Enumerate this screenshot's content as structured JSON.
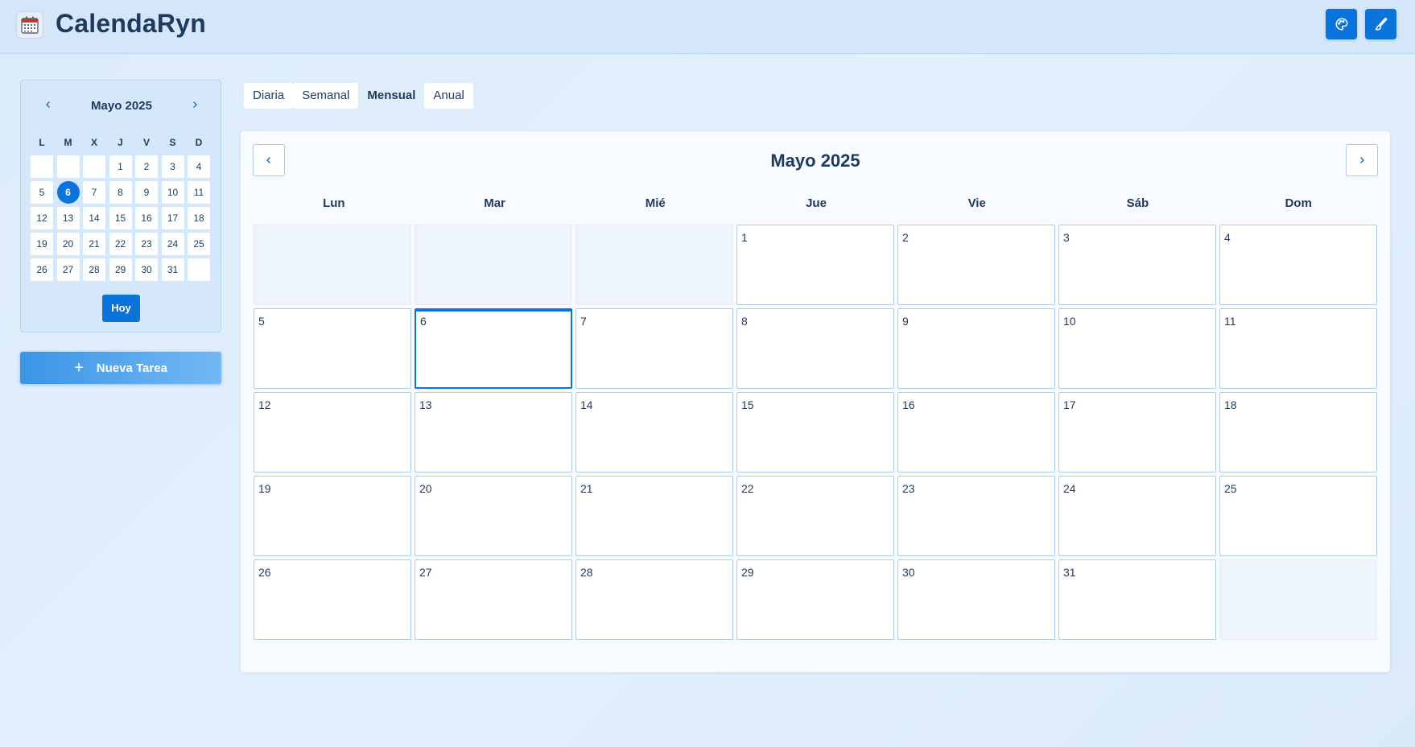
{
  "header": {
    "title": "CalendaRyn",
    "app_icon": "calendar-icon",
    "buttons": [
      {
        "icon": "palette-icon"
      },
      {
        "icon": "brush-icon"
      }
    ],
    "accent": "#0a74da"
  },
  "sidebar": {
    "mini_calendar": {
      "title": "Mayo 2025",
      "weekdays": [
        "L",
        "M",
        "X",
        "J",
        "V",
        "S",
        "D"
      ],
      "cells": [
        "",
        "",
        "",
        "1",
        "2",
        "3",
        "4",
        "5",
        "6",
        "7",
        "8",
        "9",
        "10",
        "11",
        "12",
        "13",
        "14",
        "15",
        "16",
        "17",
        "18",
        "19",
        "20",
        "21",
        "22",
        "23",
        "24",
        "25",
        "26",
        "27",
        "28",
        "29",
        "30",
        "31",
        ""
      ],
      "today": "6",
      "today_label": "Hoy"
    },
    "new_task_label": "Nueva Tarea"
  },
  "views": {
    "tabs": [
      "Diaria",
      "Semanal",
      "Mensual",
      "Anual"
    ],
    "active": "Mensual"
  },
  "month_view": {
    "title": "Mayo 2025",
    "weekdays": [
      "Lun",
      "Mar",
      "Mié",
      "Jue",
      "Vie",
      "Sáb",
      "Dom"
    ],
    "cells": [
      "",
      "",
      "",
      "1",
      "2",
      "3",
      "4",
      "5",
      "6",
      "7",
      "8",
      "9",
      "10",
      "11",
      "12",
      "13",
      "14",
      "15",
      "16",
      "17",
      "18",
      "19",
      "20",
      "21",
      "22",
      "23",
      "24",
      "25",
      "26",
      "27",
      "28",
      "29",
      "30",
      "31",
      ""
    ],
    "today": "6"
  }
}
